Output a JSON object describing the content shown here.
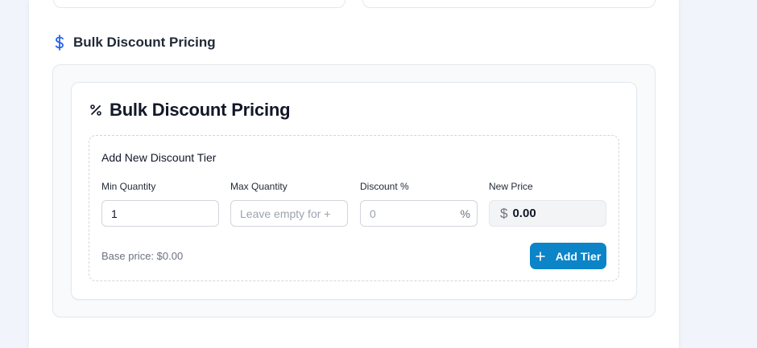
{
  "section": {
    "title": "Bulk Discount Pricing",
    "icon": "dollar-icon",
    "icon_color": "#2563eb"
  },
  "card": {
    "title": "Bulk Discount Pricing",
    "icon": "percent-icon"
  },
  "tier_form": {
    "title": "Add New Discount Tier",
    "min_quantity": {
      "label": "Min Quantity",
      "value": "1"
    },
    "max_quantity": {
      "label": "Max Quantity",
      "value": "",
      "placeholder": "Leave empty for +"
    },
    "discount": {
      "label": "Discount %",
      "value": "",
      "placeholder": "0",
      "suffix": "%"
    },
    "new_price": {
      "label": "New Price",
      "currency": "$",
      "value": "0.00"
    },
    "base_price": "Base price: $0.00",
    "add_button": {
      "label": "Add Tier",
      "icon": "plus-icon",
      "color": "#0b84c8"
    }
  }
}
